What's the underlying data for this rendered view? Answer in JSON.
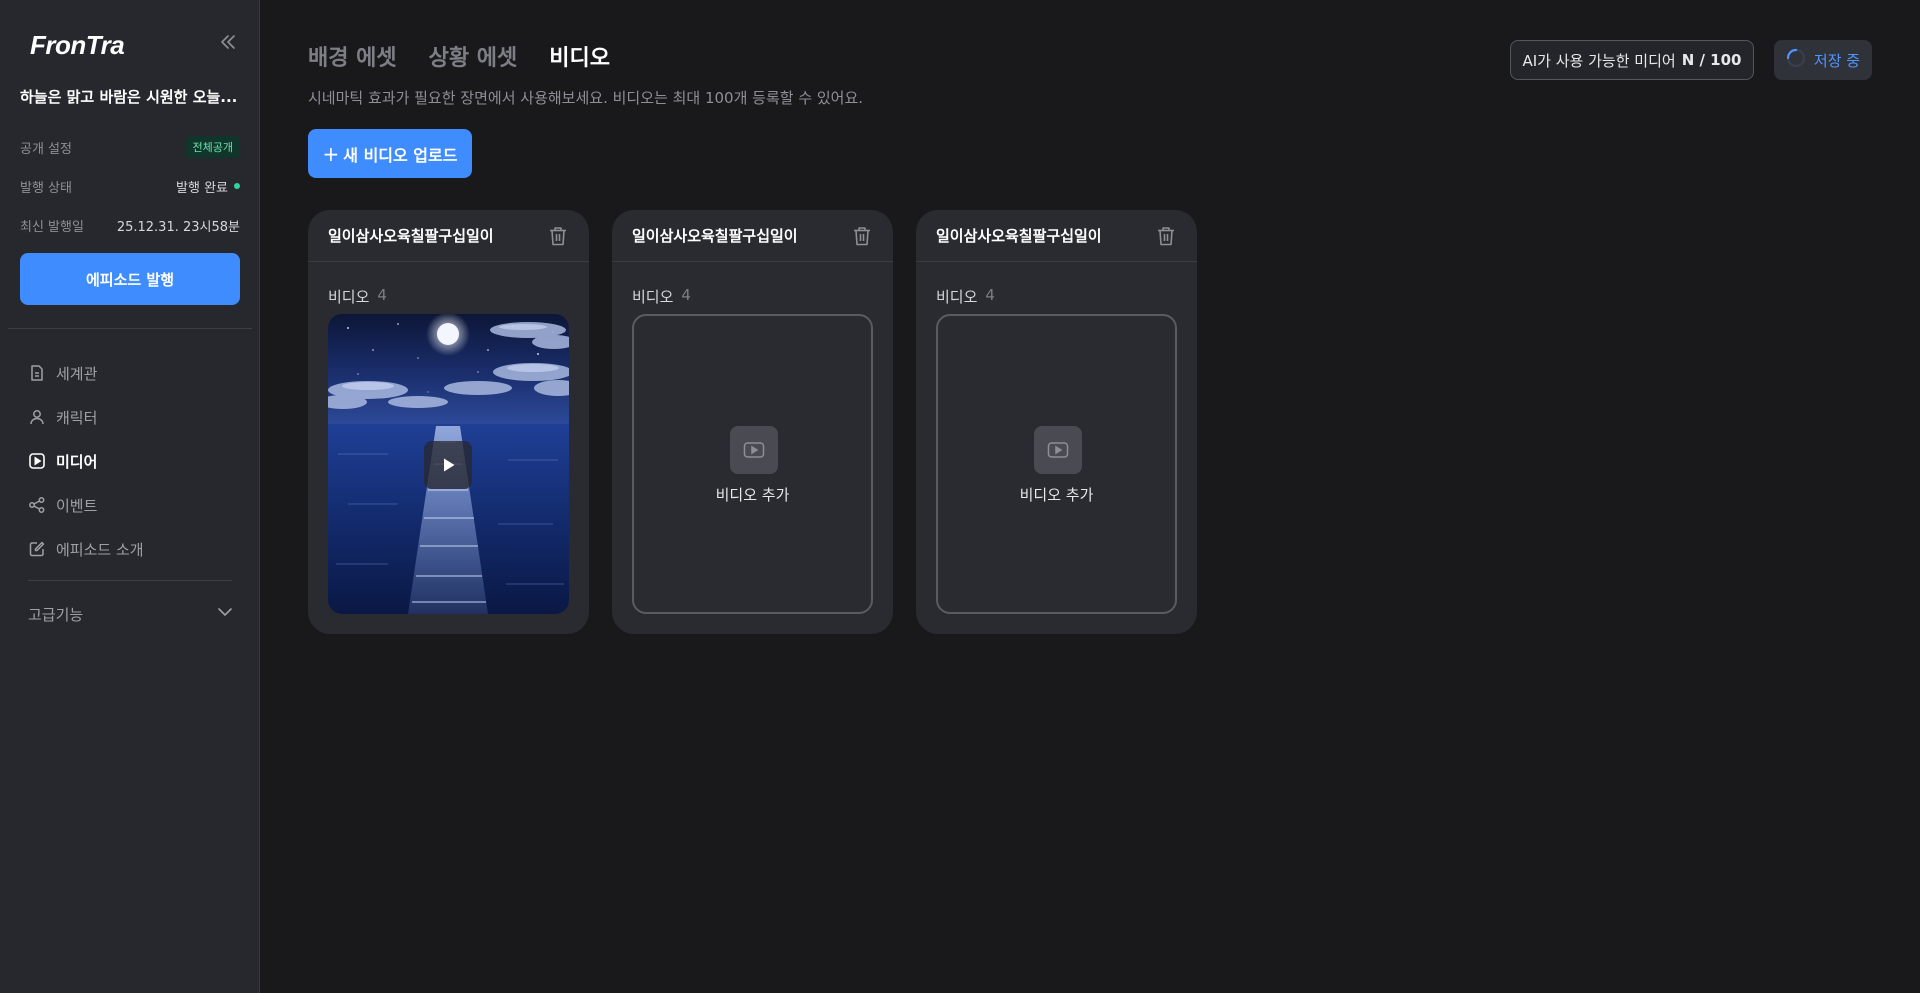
{
  "sidebar": {
    "logo": "FronTra",
    "project_title": "하늘은 맑고 바람은 시원한 오늘...",
    "visibility": {
      "label": "공개 설정",
      "value": "전체공개"
    },
    "publish_status": {
      "label": "발행 상태",
      "value": "발행 완료"
    },
    "last_published": {
      "label": "최신 발행일",
      "value": "25.12.31. 23시58분"
    },
    "publish_button": "에피소드 발행",
    "nav": [
      {
        "label": "세계관",
        "icon": "document-icon"
      },
      {
        "label": "캐릭터",
        "icon": "user-icon"
      },
      {
        "label": "미디어",
        "icon": "play-square-icon",
        "active": true
      },
      {
        "label": "이벤트",
        "icon": "share-icon"
      },
      {
        "label": "에피소드 소개",
        "icon": "edit-icon"
      }
    ],
    "advanced": "고급기능"
  },
  "main": {
    "tabs": [
      {
        "label": "배경 에셋"
      },
      {
        "label": "상황 에셋"
      },
      {
        "label": "비디오",
        "active": true
      }
    ],
    "description": "시네마틱 효과가 필요한 장면에서 사용해보세요. 비디오는 최대 100개 등록할 수 있어요.",
    "upload_button": "새 비디오 업로드",
    "ai_usage": {
      "label": "AI가 사용 가능한 미디어",
      "count": "N / 100"
    },
    "saving": "저장 중",
    "cards": [
      {
        "title": "일이삼사오육칠팔구십일이",
        "sub_label": "비디오",
        "count": "4",
        "has_video": true
      },
      {
        "title": "일이삼사오육칠팔구십일이",
        "sub_label": "비디오",
        "count": "4",
        "add_label": "비디오 추가"
      },
      {
        "title": "일이삼사오육칠팔구십일이",
        "sub_label": "비디오",
        "count": "4",
        "add_label": "비디오 추가"
      }
    ]
  },
  "colors": {
    "accent": "#3f8cff",
    "background": "#19191c",
    "sidebar": "#27282d",
    "card": "#2a2b30",
    "status_green": "#2fd59a"
  }
}
